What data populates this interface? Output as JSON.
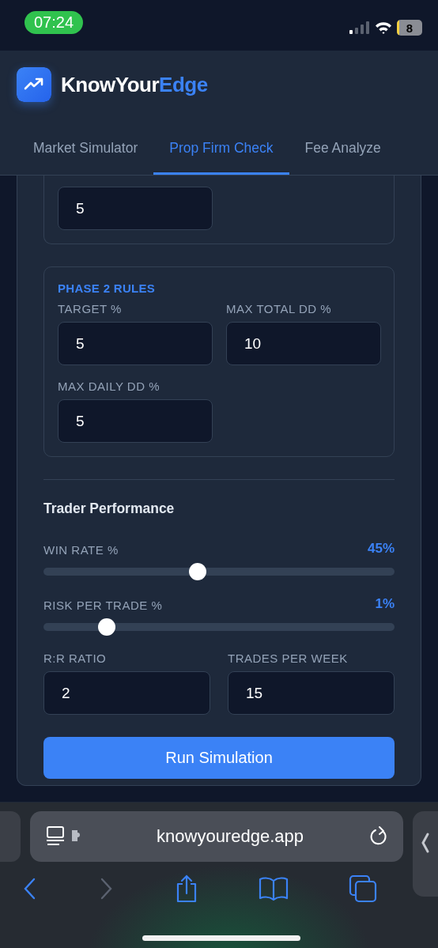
{
  "status_bar": {
    "time": "07:24",
    "battery": "8"
  },
  "header": {
    "brand": [
      {
        "text": "KnowYour",
        "accent": false
      },
      {
        "text": "Edge",
        "accent": true
      }
    ],
    "tabs": [
      {
        "label": "Market Simulator",
        "selected": false
      },
      {
        "label": "Prop Firm Check",
        "selected": true
      },
      {
        "label": "Fee Analyze",
        "selected": false
      }
    ]
  },
  "phase_1_rules": {
    "fields": [
      {
        "value": "5"
      }
    ]
  },
  "phase_2_rules": {
    "title": "PHASE 2 RULES",
    "fields": [
      {
        "label": "TARGET %",
        "value": "5"
      },
      {
        "label": "MAX TOTAL DD %",
        "value": "10"
      },
      {
        "label": "MAX DAILY DD %",
        "value": "5"
      }
    ]
  },
  "trader_performance": {
    "title": "Trader Performance",
    "sliders": [
      {
        "label": "WIN RATE %",
        "reading": "45%",
        "level": 0.44
      },
      {
        "label": "RISK PER TRADE %",
        "reading": "1%",
        "level": 0.18
      }
    ],
    "fields": [
      {
        "label": "R:R RATIO",
        "value": "2"
      },
      {
        "label": "TRADES PER WEEK",
        "value": "15"
      }
    ],
    "button": "Run Simulation"
  },
  "browser": {
    "url": "knowyouredge.app"
  }
}
